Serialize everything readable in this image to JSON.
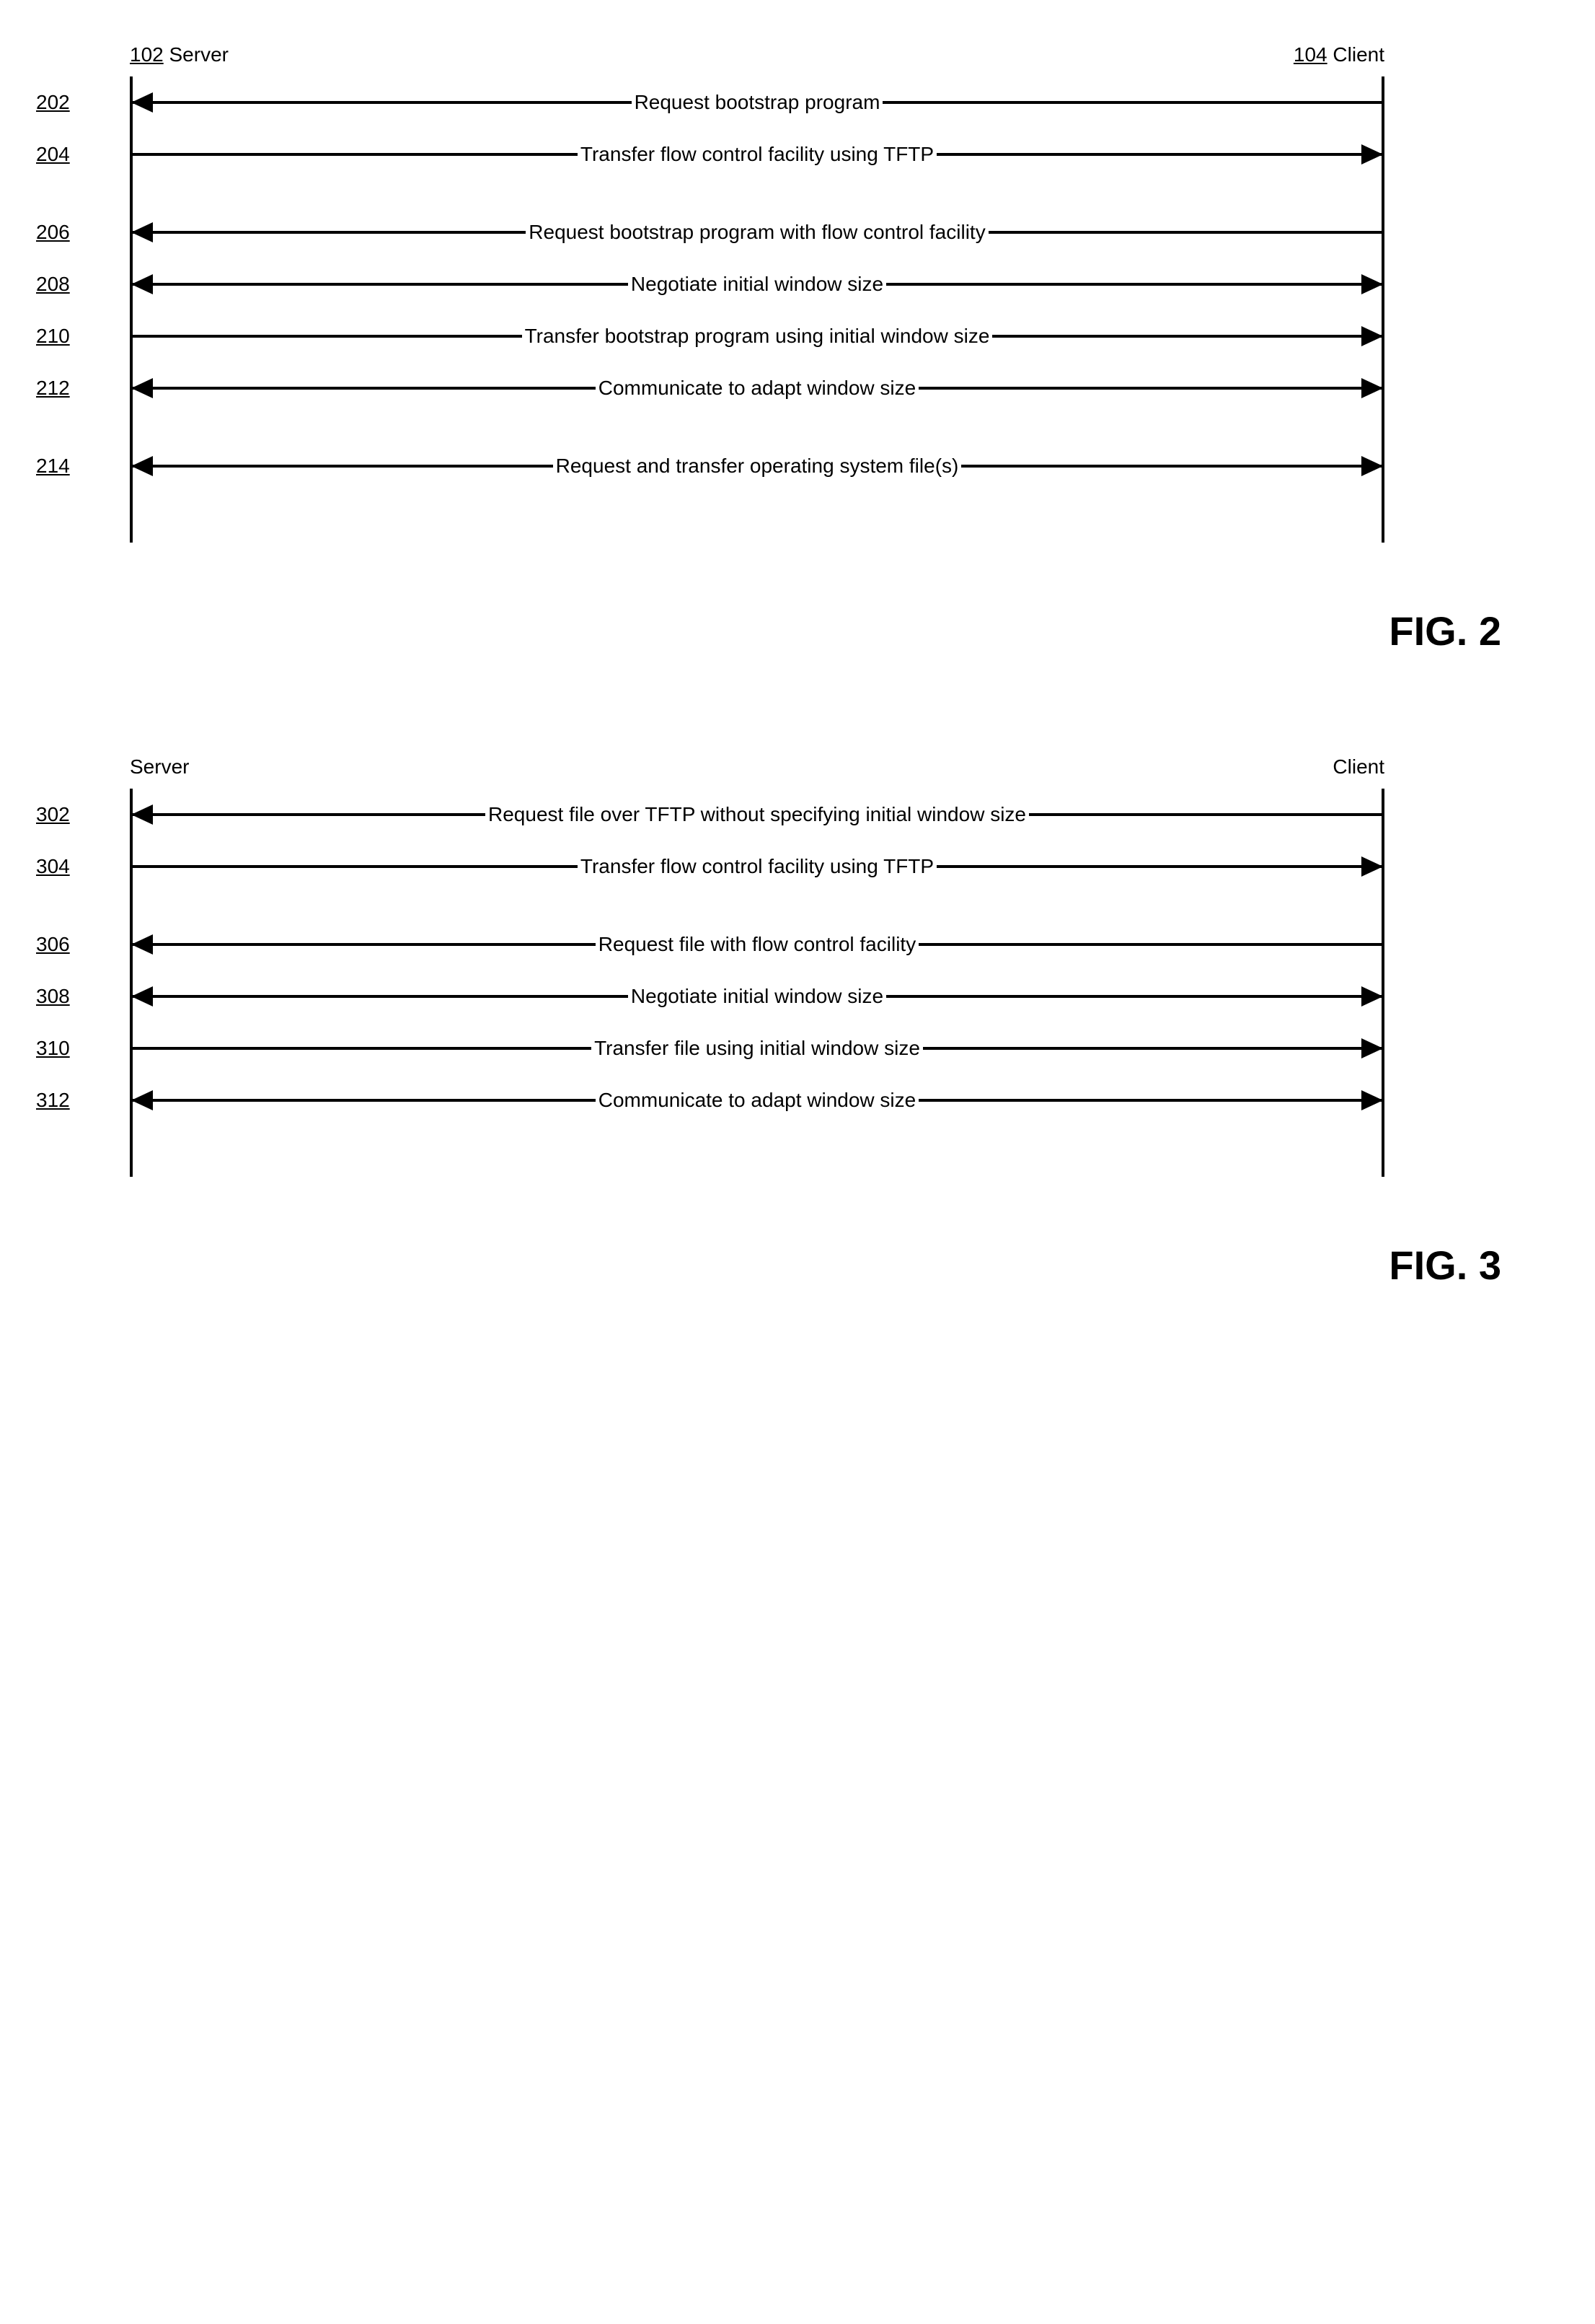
{
  "figures": [
    {
      "id": "fig2",
      "caption": "FIG. 2",
      "server_ref": "102",
      "server_label": "Server",
      "client_ref": "104",
      "client_label": "Client",
      "rows": [
        {
          "kind": "msg",
          "ref": "202",
          "text": "Request bootstrap program",
          "dir": "left"
        },
        {
          "kind": "msg",
          "ref": "204",
          "text": "Transfer flow control facility using TFTP",
          "dir": "right"
        },
        {
          "kind": "gap"
        },
        {
          "kind": "msg",
          "ref": "206",
          "text": "Request bootstrap program with flow control facility",
          "dir": "left"
        },
        {
          "kind": "msg",
          "ref": "208",
          "text": "Negotiate initial window size",
          "dir": "both"
        },
        {
          "kind": "msg",
          "ref": "210",
          "text": "Transfer bootstrap program using initial window size",
          "dir": "right"
        },
        {
          "kind": "msg",
          "ref": "212",
          "text": "Communicate to adapt window size",
          "dir": "both"
        },
        {
          "kind": "gap"
        },
        {
          "kind": "msg",
          "ref": "214",
          "text": "Request and transfer operating system file(s)",
          "dir": "both"
        },
        {
          "kind": "tail"
        }
      ]
    },
    {
      "id": "fig3",
      "caption": "FIG. 3",
      "server_ref": "",
      "server_label": "Server",
      "client_ref": "",
      "client_label": "Client",
      "rows": [
        {
          "kind": "msg",
          "ref": "302",
          "text": "Request file over TFTP without specifying initial window size",
          "dir": "left"
        },
        {
          "kind": "msg",
          "ref": "304",
          "text": "Transfer flow control facility using TFTP",
          "dir": "right"
        },
        {
          "kind": "gap"
        },
        {
          "kind": "msg",
          "ref": "306",
          "text": "Request file with flow control facility",
          "dir": "left"
        },
        {
          "kind": "msg",
          "ref": "308",
          "text": "Negotiate initial window size",
          "dir": "both"
        },
        {
          "kind": "msg",
          "ref": "310",
          "text": "Transfer file using initial window size",
          "dir": "right"
        },
        {
          "kind": "msg",
          "ref": "312",
          "text": "Communicate to adapt window size",
          "dir": "both"
        },
        {
          "kind": "tail"
        }
      ]
    }
  ]
}
